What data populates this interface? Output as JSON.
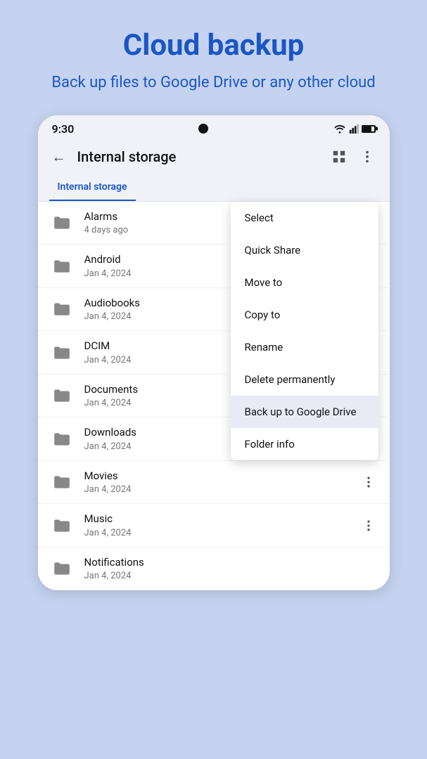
{
  "header": {
    "title": "Cloud backup",
    "subtitle": "Back up files to Google Drive or any other cloud"
  },
  "phone": {
    "statusBar": {
      "time": "9:30"
    },
    "toolbar": {
      "title": "Internal storage",
      "backLabel": "←"
    },
    "tab": {
      "label": "Internal storage"
    },
    "folders": [
      {
        "name": "Alarms",
        "date": "4 days ago",
        "showMore": true
      },
      {
        "name": "Android",
        "date": "Jan 4, 2024",
        "showMore": false
      },
      {
        "name": "Audiobooks",
        "date": "Jan 4, 2024",
        "showMore": false
      },
      {
        "name": "DCIM",
        "date": "Jan 4, 2024",
        "showMore": false
      },
      {
        "name": "Documents",
        "date": "Jan 4, 2024",
        "showMore": false
      },
      {
        "name": "Downloads",
        "date": "Jan 4, 2024",
        "showMore": false
      },
      {
        "name": "Movies",
        "date": "Jan 4, 2024",
        "showMore": true
      },
      {
        "name": "Music",
        "date": "Jan 4, 2024",
        "showMore": true
      },
      {
        "name": "Notifications",
        "date": "Jan 4, 2024",
        "showMore": false
      }
    ],
    "contextMenu": {
      "items": [
        {
          "label": "Select",
          "highlighted": false
        },
        {
          "label": "Quick Share",
          "highlighted": false
        },
        {
          "label": "Move to",
          "highlighted": false
        },
        {
          "label": "Copy to",
          "highlighted": false
        },
        {
          "label": "Rename",
          "highlighted": false
        },
        {
          "label": "Delete permanently",
          "highlighted": false
        },
        {
          "label": "Back up to Google Drive",
          "highlighted": true
        },
        {
          "label": "Folder info",
          "highlighted": false
        }
      ]
    }
  }
}
